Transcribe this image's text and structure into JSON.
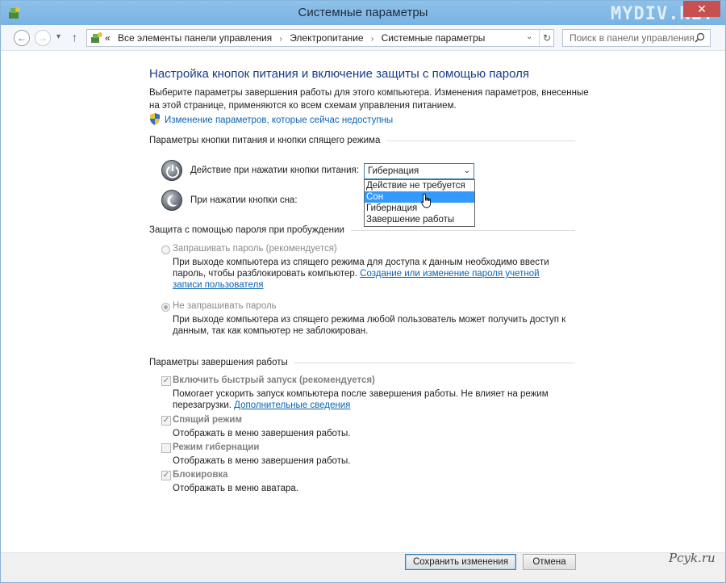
{
  "window": {
    "title": "Системные параметры",
    "watermark": "MYDIV.NET",
    "close_glyph": "✕"
  },
  "nav": {
    "back_glyph": "←",
    "forward_glyph": "→",
    "recent_glyph": "▾",
    "up_glyph": "↑",
    "crumb_prefix": "«",
    "breadcrumbs": [
      "Все элементы панели управления",
      "Электропитание",
      "Системные параметры"
    ],
    "crumb_sep": "›",
    "dropdown_glyph": "⌄",
    "refresh_glyph": "↻",
    "search_placeholder": "Поиск в панели управления"
  },
  "content": {
    "page_title": "Настройка кнопок питания и включение защиты с помощью пароля",
    "description": "Выберите параметры завершения работы для этого компьютера. Изменения параметров, внесенные на этой странице, применяются ко всем схемам управления питанием.",
    "unavailable_link": "Изменение параметров, которые сейчас недоступны",
    "power_section": {
      "title": "Параметры кнопки питания и кнопки спящего режима",
      "power_button_label": "Действие при нажатии кнопки питания:",
      "power_button_value": "Гибернация",
      "sleep_button_label": "При нажатии кнопки сна:",
      "dropdown_arrow": "⌄",
      "dropdown_options": [
        "Действие не требуется",
        "Сон",
        "Гибернация",
        "Завершение работы"
      ],
      "dropdown_selected_index": 1
    },
    "password_section": {
      "title": "Защита с помощью пароля при пробуждении",
      "option1_label": "Запрашивать пароль (рекомендуется)",
      "option1_desc_a": "При выходе компьютера из спящего режима для доступа к данным необходимо ввести пароль, чтобы разблокировать компьютер. ",
      "option1_link": "Создание или изменение пароля учетной записи пользователя",
      "option2_label": "Не запрашивать пароль",
      "option2_desc": "При выходе компьютера из спящего режима любой пользователь может получить доступ к данным, так как компьютер не заблокирован."
    },
    "shutdown_section": {
      "title": "Параметры завершения работы",
      "items": [
        {
          "label": "Включить быстрый запуск (рекомендуется)",
          "checked": true
        },
        {
          "label": "Спящий режим",
          "checked": true
        },
        {
          "label": "Режим гибернации",
          "checked": false
        },
        {
          "label": "Блокировка",
          "checked": true
        }
      ],
      "fast_desc_a": "Помогает ускорить запуск компьютера после завершения работы. Не влияет на режим перезагрузки. ",
      "fast_link": "Дополнительные сведения",
      "sleep_desc": "Отображать в меню завершения работы.",
      "hibernate_desc": "Отображать в меню завершения работы.",
      "lock_desc": "Отображать в меню аватара.",
      "check_glyph": "✓"
    }
  },
  "footer": {
    "save_label": "Сохранить изменения",
    "cancel_label": "Отмена",
    "site_watermark": "Pcyk.ru"
  },
  "colors": {
    "titlebar": "#79b2e2",
    "link": "#0b64b4",
    "page_title": "#1a3a8a",
    "dropdown_highlight": "#3399ff",
    "close_button": "#c75050"
  }
}
